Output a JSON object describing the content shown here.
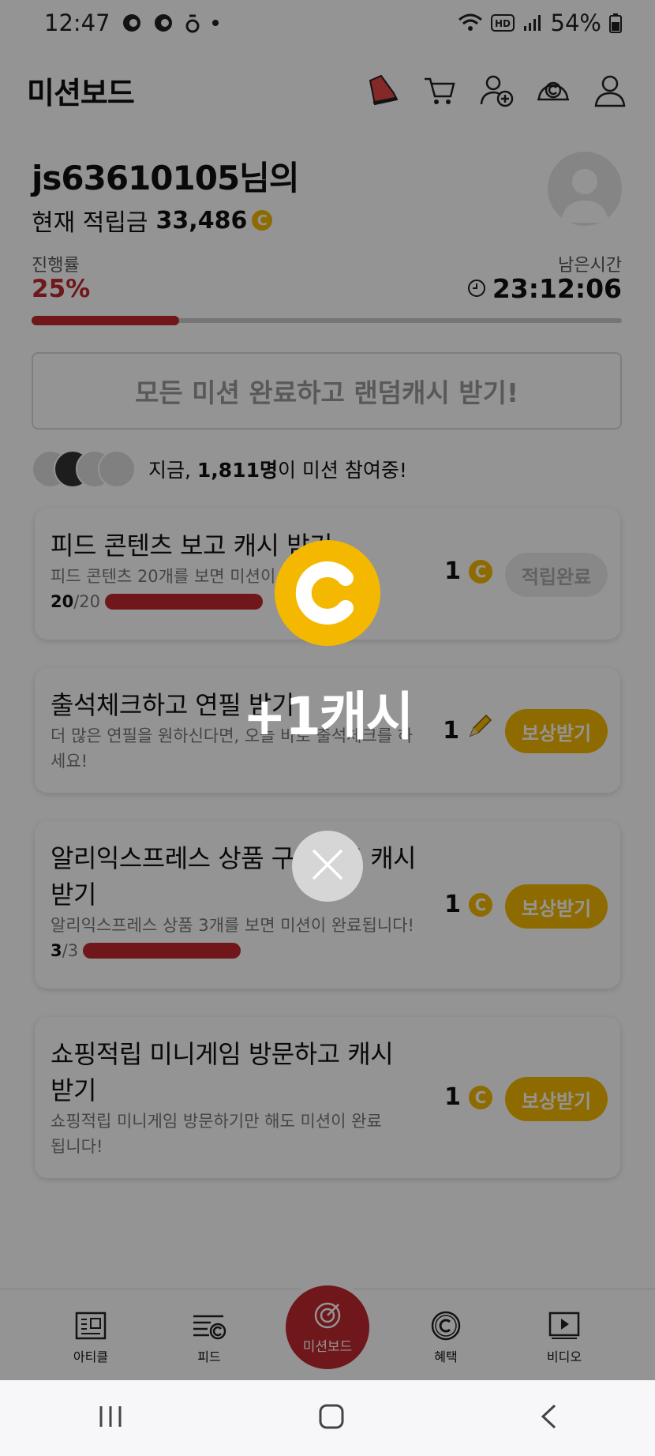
{
  "status_bar": {
    "time": "12:47",
    "battery": "54%"
  },
  "header": {
    "title": "미션보드"
  },
  "user": {
    "name": "js63610105님의",
    "balance_label": "현재 적립금",
    "balance": "33,486",
    "coin_glyph": "C"
  },
  "progress": {
    "label": "진행률",
    "value": "25%",
    "fraction": 0.25
  },
  "remaining": {
    "label": "남은시간",
    "value": "23:12:06"
  },
  "all_missions_button": "모든 미션 완료하고 랜덤캐시 받기!",
  "participants": {
    "prefix": "지금, ",
    "count": "1,811명",
    "suffix": "이 미션 참여중!"
  },
  "missions": [
    {
      "title": "피드 콘텐츠 보고 캐시 받기",
      "desc": "피드 콘텐츠 20개를 보면 미션이",
      "progress_done": "20",
      "progress_total": "/20",
      "progress_fraction": 1.0,
      "reward": "1",
      "button": "적립완료"
    },
    {
      "title": "출석체크하고 연필 받기",
      "desc": "더 많은 연필을 원하신다면, 오늘 바로 출석체크를 하세요!",
      "reward": "1",
      "button": "보상받기"
    },
    {
      "title": "알리익스프레스 상품 구경하고 캐시받기",
      "desc": "알리익스프레스 상품 3개를 보면 미션이 완료됩니다!",
      "progress_done": "3",
      "progress_total": "/3",
      "progress_fraction": 1.0,
      "reward": "1",
      "button": "보상받기"
    },
    {
      "title": "쇼핑적립 미니게임 방문하고 캐시 받기",
      "desc": "쇼핑적립 미니게임 방문하기만 해도 미션이 완료됩니다!",
      "reward": "1",
      "button": "보상받기"
    }
  ],
  "bottom_nav": {
    "article": "아티클",
    "feed": "피드",
    "mission": "미션보드",
    "benefit": "혜택",
    "video": "비디오"
  },
  "popup": {
    "message": "+1캐시"
  },
  "colors": {
    "accent_red": "#c0282d",
    "coin_yellow": "#f5b800"
  },
  "icons": [
    "sneaker-icon",
    "cart-icon",
    "add-friend-icon",
    "cash-icon",
    "profile-icon",
    "clock-icon",
    "close-icon"
  ]
}
